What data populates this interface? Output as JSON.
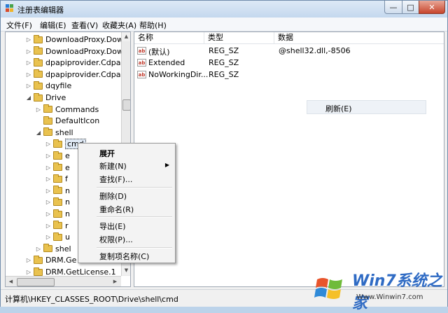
{
  "window": {
    "title": "注册表编辑器"
  },
  "controls": {
    "minimize": "—",
    "maximize": "□",
    "close": "✕"
  },
  "menu": [
    "文件(F)",
    "编辑(E)",
    "查看(V)",
    "收藏夹(A)",
    "帮助(H)"
  ],
  "tree": [
    {
      "label": "DownloadProxy.Dow",
      "indent": 1,
      "arrow": "▷"
    },
    {
      "label": "DownloadProxy.Dow",
      "indent": 1,
      "arrow": "▷"
    },
    {
      "label": "dpapiprovider.Cdpa",
      "indent": 1,
      "arrow": "▷"
    },
    {
      "label": "dpapiprovider.Cdpa",
      "indent": 1,
      "arrow": "▷"
    },
    {
      "label": "dqyfile",
      "indent": 1,
      "arrow": "▷"
    },
    {
      "label": "Drive",
      "indent": 1,
      "arrow": "◢"
    },
    {
      "label": "Commands",
      "indent": 2,
      "arrow": "▷"
    },
    {
      "label": "DefaultIcon",
      "indent": 2,
      "arrow": ""
    },
    {
      "label": "shell",
      "indent": 2,
      "arrow": "◢"
    },
    {
      "label": "cmd",
      "indent": 3,
      "arrow": "▷",
      "selected": true
    },
    {
      "label": "e",
      "indent": 3,
      "arrow": "▷"
    },
    {
      "label": "e",
      "indent": 3,
      "arrow": "▷"
    },
    {
      "label": "f",
      "indent": 3,
      "arrow": "▷"
    },
    {
      "label": "n",
      "indent": 3,
      "arrow": "▷"
    },
    {
      "label": "n",
      "indent": 3,
      "arrow": "▷"
    },
    {
      "label": "n",
      "indent": 3,
      "arrow": "▷"
    },
    {
      "label": "r",
      "indent": 3,
      "arrow": "▷"
    },
    {
      "label": "u",
      "indent": 3,
      "arrow": "▷"
    },
    {
      "label": "shel",
      "indent": 2,
      "arrow": "▷"
    },
    {
      "label": "DRM.Ge",
      "indent": 1,
      "arrow": "▷"
    },
    {
      "label": "DRM.GetLicense.1",
      "indent": 1,
      "arrow": "▷"
    }
  ],
  "columns": [
    "名称",
    "类型",
    "数据"
  ],
  "rows": [
    {
      "name": "(默认)",
      "type": "REG_SZ",
      "data": "@shell32.dll,-8506"
    },
    {
      "name": "Extended",
      "type": "REG_SZ",
      "data": ""
    },
    {
      "name": "NoWorkingDir...",
      "type": "REG_SZ",
      "data": ""
    }
  ],
  "value_icon": "ab",
  "list_context": {
    "refresh": "刷新(E)"
  },
  "context_menu": [
    {
      "label": "展开",
      "bold": true
    },
    {
      "label": "新建(N)",
      "submenu": true
    },
    {
      "label": "查找(F)..."
    },
    {
      "label": "删除(D)"
    },
    {
      "label": "重命名(R)"
    },
    {
      "label": "导出(E)"
    },
    {
      "label": "权限(P)..."
    },
    {
      "label": "复制项名称(C)"
    }
  ],
  "status": {
    "path": "计算机\\HKEY_CLASSES_ROOT\\Drive\\shell\\cmd"
  },
  "watermark": {
    "brand": "Win7系统之家",
    "url": "Www.Winwin7.com"
  }
}
